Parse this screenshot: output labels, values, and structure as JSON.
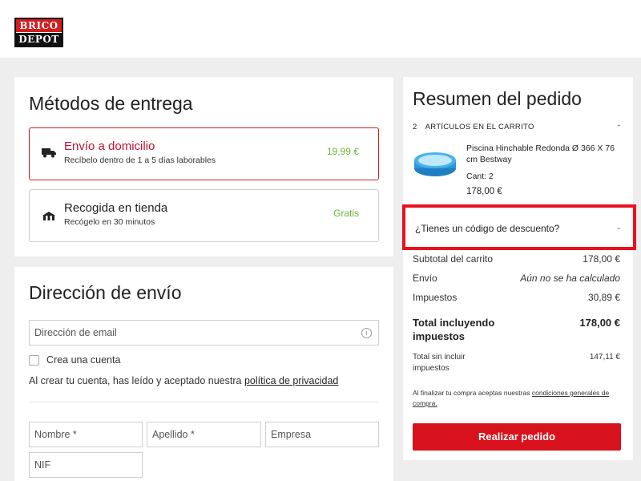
{
  "brand": {
    "line1": "BRICO",
    "line2": "DEPOT"
  },
  "delivery": {
    "title": "Métodos de entrega",
    "options": [
      {
        "title": "Envío a domicilio",
        "subtitle": "Recíbelo dentro de 1 a 5 días laborables",
        "price": "19,99 €",
        "icon": "truck-icon",
        "selected": true
      },
      {
        "title": "Recogida en tienda",
        "subtitle": "Recógelo en 30 minutos",
        "price": "Gratis",
        "icon": "store-pickup-icon",
        "selected": false
      }
    ]
  },
  "address": {
    "title": "Dirección de envío",
    "email_placeholder": "Dirección de email",
    "create_account_label": "Crea una cuenta",
    "terms_prefix": "Al crear tu cuenta, has leído y aceptado nuestra",
    "terms_link": "política de privacidad",
    "first_name_placeholder": "Nombre *",
    "last_name_placeholder": "Apellido *",
    "company_placeholder": "Empresa",
    "nif_placeholder": "NIF"
  },
  "summary": {
    "title": "Resumen del pedido",
    "cart_count": "2",
    "cart_label": "ARTÍCULOS EN EL CARRITO",
    "product": {
      "name": "Piscina Hinchable Redonda Ø 366 X 76 cm Bestway",
      "qty": "Cant: 2",
      "price": "178,00 €"
    },
    "discount_label": "¿Tienes un código de descuento?",
    "subtotal_label": "Subtotal del carrito",
    "subtotal_value": "178,00 €",
    "shipping_label": "Envío",
    "shipping_value": "Aún no se ha calculado",
    "tax_label": "Impuestos",
    "tax_value": "30,89 €",
    "total_incl_label": "Total incluyendo impuestos",
    "total_incl_value": "178,00 €",
    "total_excl_label": "Total sin incluir impuestos",
    "total_excl_value": "147,11 €",
    "legal_prefix": "Al finalizar tu compra aceptas nuestras",
    "legal_link": "condiciones generales de compra.",
    "order_button": "Realizar pedido"
  },
  "colors": {
    "accent": "#d8121c",
    "price_green": "#6fb23a",
    "highlight": "#e8121d"
  }
}
